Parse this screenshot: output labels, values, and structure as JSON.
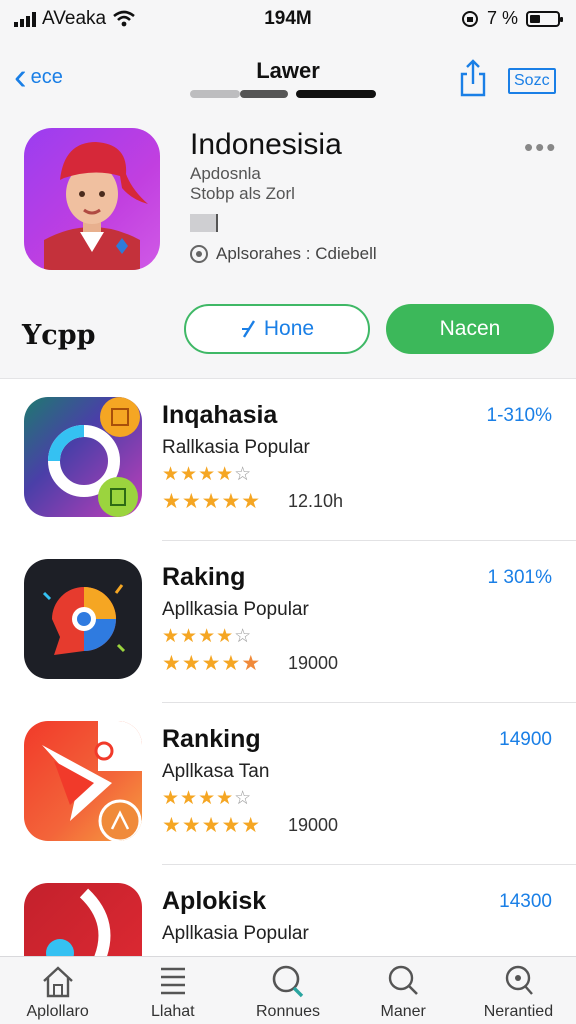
{
  "status_bar": {
    "carrier": "AVeaka",
    "time": "194M",
    "battery_text": "7 %"
  },
  "header": {
    "back_label": "ece",
    "title": "Lawer",
    "sort_label": "Sozc"
  },
  "app": {
    "name": "Indonesisia",
    "subtitle_1": "Apdosnla",
    "subtitle_2": "Stobp als Zorl",
    "meta_text": "Aplsorahes : Cdiebell",
    "more_icon": "ellipsis-icon"
  },
  "actions": {
    "section_label": "Ycpp",
    "outline_button_label": "Hone",
    "solid_button_label": "Nacen"
  },
  "list": {
    "items": [
      {
        "name": "Inqahasia",
        "subtitle": "Rallkasia Popular",
        "count": "12.10h",
        "value": "1-310%",
        "rating_top": 4.5,
        "rating_bottom": 5
      },
      {
        "name": "Raking",
        "subtitle": "Apllkasia Popular",
        "count": "19000",
        "value": "1 301%",
        "rating_top": 4.5,
        "rating_bottom": 5
      },
      {
        "name": "Ranking",
        "subtitle": "Apllkasa Tan",
        "count": "19000",
        "value": "14900",
        "rating_top": 4.5,
        "rating_bottom": 5
      },
      {
        "name": "Aplokisk",
        "subtitle": "Apllkasia Popular",
        "count": "",
        "value": "14300",
        "rating_top": 0,
        "rating_bottom": 0
      }
    ]
  },
  "tabbar": {
    "tabs": [
      {
        "label": "Aplollaro",
        "icon": "home-icon"
      },
      {
        "label": "Llahat",
        "icon": "list-icon"
      },
      {
        "label": "Ronnues",
        "icon": "search-icon"
      },
      {
        "label": "Maner",
        "icon": "search-icon"
      },
      {
        "label": "Nerantied",
        "icon": "ranking-icon"
      }
    ]
  },
  "colors": {
    "accent": "#1a7fe6",
    "green": "#3cb85a",
    "star": "#f5a623"
  }
}
